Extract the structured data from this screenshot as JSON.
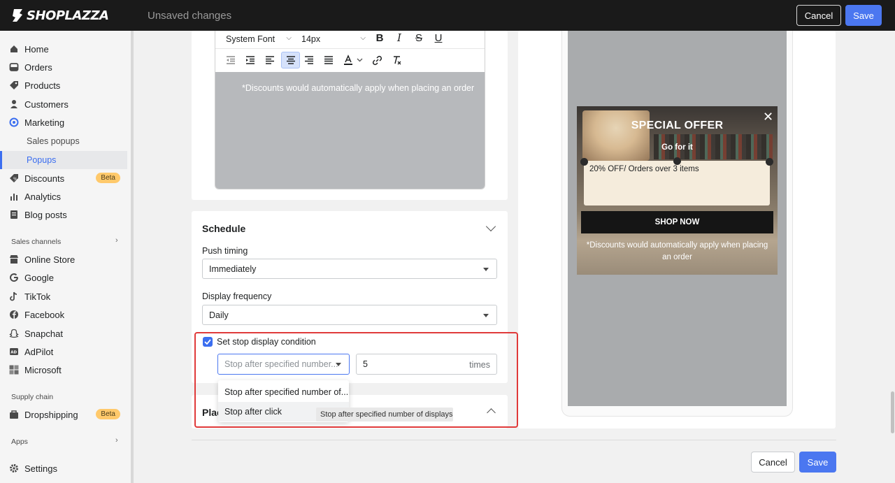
{
  "topbar": {
    "logo_text": "SHOPLAZZA",
    "status": "Unsaved changes",
    "cancel_label": "Cancel",
    "save_label": "Save"
  },
  "sidebar": {
    "items": [
      {
        "label": "Home",
        "icon": "home-icon"
      },
      {
        "label": "Orders",
        "icon": "inbox-icon"
      },
      {
        "label": "Products",
        "icon": "tag-icon"
      },
      {
        "label": "Customers",
        "icon": "person-icon"
      },
      {
        "label": "Marketing",
        "icon": "target-icon"
      },
      {
        "label": "Discounts",
        "icon": "discount-icon",
        "badge": "Beta"
      },
      {
        "label": "Analytics",
        "icon": "bar-chart-icon"
      },
      {
        "label": "Blog posts",
        "icon": "document-icon"
      },
      {
        "label": "Online Store",
        "icon": "store-icon"
      },
      {
        "label": "Google",
        "icon": "google-icon"
      },
      {
        "label": "TikTok",
        "icon": "tiktok-icon"
      },
      {
        "label": "Facebook",
        "icon": "facebook-icon"
      },
      {
        "label": "Snapchat",
        "icon": "snapchat-icon"
      },
      {
        "label": "AdPilot",
        "icon": "adpilot-icon"
      },
      {
        "label": "Microsoft",
        "icon": "microsoft-icon"
      },
      {
        "label": "Dropshipping",
        "icon": "dropshipping-icon",
        "badge": "Beta"
      },
      {
        "label": "Settings",
        "icon": "gear-icon"
      }
    ],
    "sub_items": [
      {
        "label": "Sales popups"
      },
      {
        "label": "Popups"
      }
    ],
    "sections": {
      "sales_channels": "Sales channels",
      "supply_chain": "Supply chain",
      "apps": "Apps"
    }
  },
  "editor": {
    "font_family": "System Font",
    "font_size": "14px",
    "body_text": "*Discounts would automatically apply when placing an order"
  },
  "schedule": {
    "title": "Schedule",
    "push_timing_label": "Push timing",
    "push_timing_value": "Immediately",
    "display_frequency_label": "Display frequency",
    "display_frequency_value": "Daily",
    "stop_condition_label": "Set stop display condition",
    "stop_condition_checked": true,
    "stop_select_value": "Stop after specified number...",
    "times_value": "5",
    "times_suffix": "times"
  },
  "dropdown": {
    "options": [
      {
        "label": "Stop after specified number of..."
      },
      {
        "label": "Stop after click"
      }
    ],
    "tooltip": "Stop after specified number of displays"
  },
  "placement": {
    "title": "Plac"
  },
  "preview": {
    "title": "SPECIAL OFFER",
    "subtitle": "Go for it",
    "coupon_text": "20% OFF/ Orders over 3 items",
    "shop_button": "SHOP NOW",
    "note": "*Discounts would automatically apply when placing an order"
  },
  "footer": {
    "cancel_label": "Cancel",
    "save_label": "Save"
  },
  "colors": {
    "accent": "#4b77f0",
    "highlight": "#e03a3a",
    "badge": "#ffc96b"
  }
}
